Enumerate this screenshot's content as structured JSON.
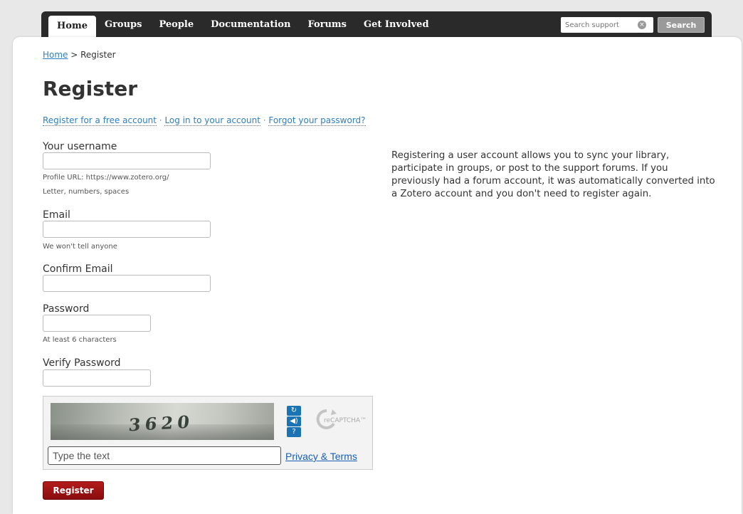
{
  "nav": {
    "items": [
      {
        "label": "Home",
        "active": true
      },
      {
        "label": "Groups"
      },
      {
        "label": "People"
      },
      {
        "label": "Documentation"
      },
      {
        "label": "Forums"
      },
      {
        "label": "Get Involved"
      }
    ],
    "search_placeholder": "Search support",
    "search_button": "Search",
    "clear_icon": "circle-x-icon"
  },
  "breadcrumb": {
    "home": "Home",
    "separator": " > ",
    "current": "Register"
  },
  "page_title": "Register",
  "sublinks": {
    "register": "Register for a free account",
    "login": "Log in to your account",
    "forgot": "Forgot your password?",
    "separator": " · "
  },
  "form": {
    "username_label": "Your username",
    "username_hint1": "Profile URL: https://www.zotero.org/",
    "username_hint2": "Letter, numbers, spaces",
    "email_label": "Email",
    "email_hint": "We won't tell anyone",
    "confirm_email_label": "Confirm Email",
    "password_label": "Password",
    "password_hint": "At least 6 characters",
    "verify_password_label": "Verify Password",
    "register_button": "Register"
  },
  "info_text": "Registering a user account allows you to sync your library, participate in groups, or post to the support forums. If you previously had a forum account, it was automatically converted into a Zotero account and you don't need to register again.",
  "captcha": {
    "image_text": "3620",
    "input_placeholder": "Type the text",
    "privacy_link": "Privacy & Terms",
    "logo_text": "reCAPTCHA™",
    "icons": [
      "refresh-icon",
      "audio-icon",
      "help-icon"
    ]
  },
  "colors": {
    "nav_bg": "#2a2a2a",
    "link": "#2e7fc2",
    "register_button": "#9e1414",
    "captcha_blue": "#1a73b5"
  }
}
